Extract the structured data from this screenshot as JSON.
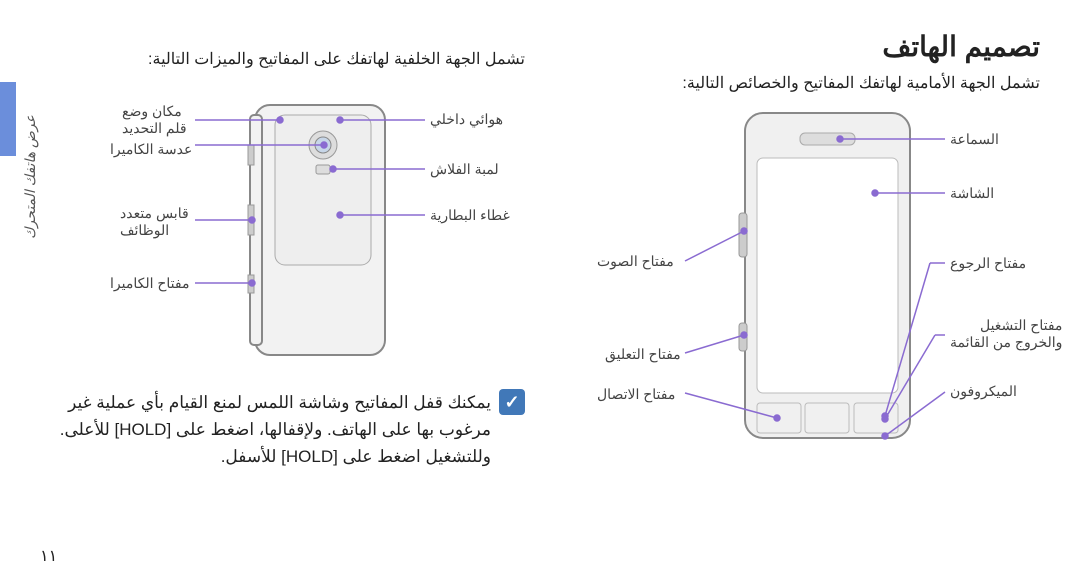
{
  "title": "تصميم الهاتف",
  "front_sub": "تشمل الجهة الأمامية لهاتفك المفاتيح  والخصائص التالية:",
  "back_sub": "تشمل الجهة الخلفية لهاتفك على المفاتيح والميزات التالية:",
  "side_label": "عرض هاتفك المتحرك",
  "page_number": "١١",
  "front": {
    "speaker": "السماعة",
    "screen": "الشاشة",
    "back_key": "مفتاح الرجوع",
    "power_key": "مفتاح التشغيل\nوالخروج من القائمة",
    "mic": "الميكروفون",
    "volume": "مفتاح الصوت",
    "hold": "مفتاح التعليق",
    "call": "مفتاح الاتصال"
  },
  "back": {
    "antenna": "هوائي داخلي",
    "flash": "لمبة الفلاش",
    "cover": "غطاء البطارية",
    "strap": "مكان وضع\nقلم التحديد",
    "lens": "عدسة الكاميرا",
    "multi": "قابس متعدد\nالوظائف",
    "cam_key": "مفتاح الكاميرا"
  },
  "note_text": "يمكنك قفل المفاتيح وشاشة اللمس لمنع القيام بأي عملية غير مرغوب بها على الهاتف. ولإقفالها، اضغط على [HOLD] للأعلى. وللتشغيل اضغط على [HOLD] للأسفل."
}
